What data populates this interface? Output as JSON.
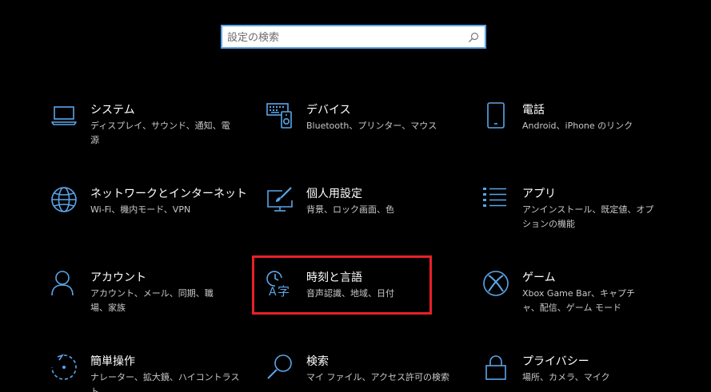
{
  "search": {
    "placeholder": "設定の検索",
    "value": ""
  },
  "accent_color": "#5aa5e8",
  "highlight_color": "#e8202a",
  "tiles": [
    {
      "name": "system",
      "icon": "laptop-icon",
      "title": "システム",
      "desc": "ディスプレイ、サウンド、通知、電源"
    },
    {
      "name": "devices",
      "icon": "keyboard-devices-icon",
      "title": "デバイス",
      "desc": "Bluetooth、プリンター、マウス"
    },
    {
      "name": "phone",
      "icon": "phone-icon",
      "title": "電話",
      "desc": "Android、iPhone のリンク"
    },
    {
      "name": "network",
      "icon": "globe-icon",
      "title": "ネットワークとインターネット",
      "desc": "Wi-Fi、機内モード、VPN"
    },
    {
      "name": "personalization",
      "icon": "paint-screen-icon",
      "title": "個人用設定",
      "desc": "背景、ロック画面、色"
    },
    {
      "name": "apps",
      "icon": "apps-list-icon",
      "title": "アプリ",
      "desc": "アンインストール、既定値、オプションの機能"
    },
    {
      "name": "accounts",
      "icon": "person-icon",
      "title": "アカウント",
      "desc": "アカウント、メール、同期、職場、家族"
    },
    {
      "name": "time-language",
      "icon": "time-language-icon",
      "title": "時刻と言語",
      "desc": "音声認識、地域、日付"
    },
    {
      "name": "gaming",
      "icon": "xbox-icon",
      "title": "ゲーム",
      "desc": "Xbox Game Bar、キャプチャ、配信、ゲーム モード"
    },
    {
      "name": "ease-of-access",
      "icon": "ease-of-access-icon",
      "title": "簡単操作",
      "desc": "ナレーター、拡大鏡、ハイコントラスト"
    },
    {
      "name": "search",
      "icon": "magnifier-icon",
      "title": "検索",
      "desc": "マイ ファイル、アクセス許可の検索"
    },
    {
      "name": "privacy",
      "icon": "lock-icon",
      "title": "プライバシー",
      "desc": "場所、カメラ、マイク"
    }
  ]
}
